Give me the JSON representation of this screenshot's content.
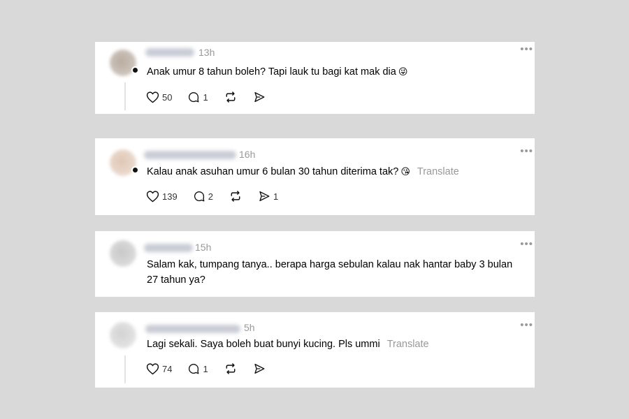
{
  "comments": [
    {
      "time": "13h",
      "text": "Anak umur 8 tahun boleh? Tapi lauk tu bagi kat mak dia",
      "emoji": "😜",
      "translate": "",
      "likes": "50",
      "replies": "1",
      "reposts": "",
      "shares": "",
      "more": "•••"
    },
    {
      "time": "16h",
      "text": "Kalau anak asuhan umur 6 bulan 30 tahun diterima tak?",
      "emoji": "😘",
      "translate": "Translate",
      "likes": "139",
      "replies": "2",
      "reposts": "",
      "shares": "1",
      "more": "•••"
    },
    {
      "time": "15h",
      "text_line1": "Salam kak, tumpang tanya.. berapa harga sebulan kalau nak hantar baby 3 bulan",
      "text_line2": "27 tahun ya?",
      "more": "•••"
    },
    {
      "time": "5h",
      "text": "Lagi sekali. Saya boleh buat bunyi kucing. Pls ummi",
      "translate": "Translate",
      "likes": "74",
      "replies": "1",
      "reposts": "",
      "shares": "",
      "more": "•••"
    }
  ],
  "icons": [
    "heart-icon",
    "comment-icon",
    "repost-icon",
    "share-icon",
    "more-icon"
  ],
  "colors": {
    "background": "#d9d9d9",
    "card": "#ffffff",
    "muted": "#999999"
  }
}
